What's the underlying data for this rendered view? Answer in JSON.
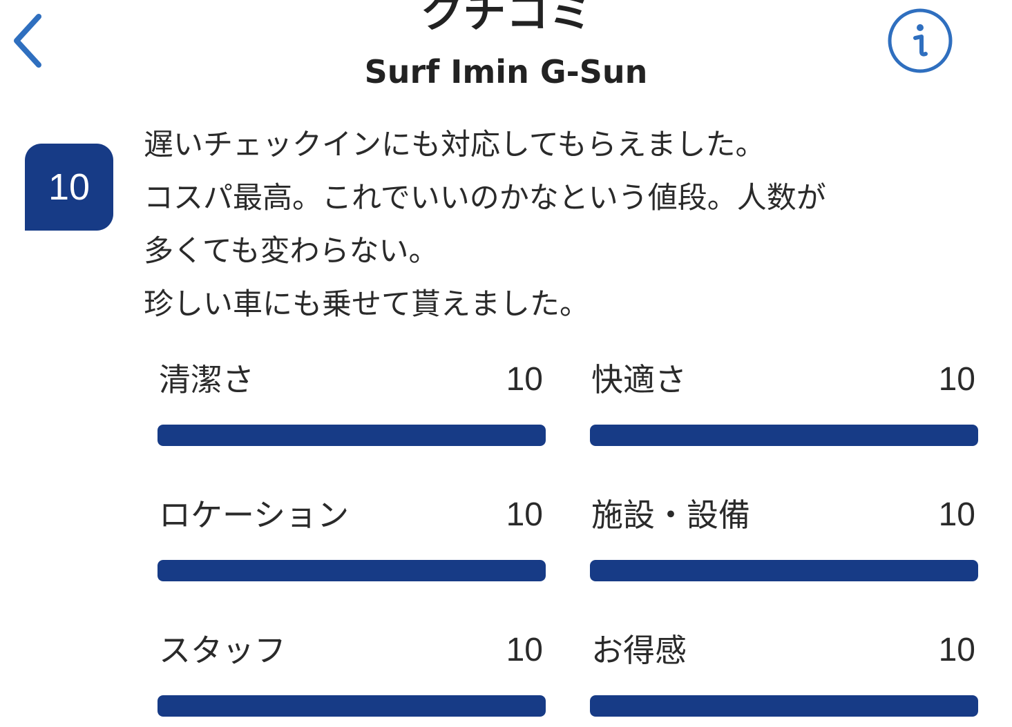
{
  "header": {
    "title": "クチコミ",
    "subtitle": "Surf Imin G-Sun",
    "back_icon": "chevron-left-icon",
    "info_icon": "info-icon"
  },
  "review": {
    "score": "10",
    "comment_lines": [
      "遅いチェックインにも対応してもらえました。",
      "コスパ最高。これでいいのかなという値段。人数が",
      "多くても変わらない。",
      "珍しい車にも乗せて貰えました。"
    ],
    "ratings": [
      {
        "label": "清潔さ",
        "value": "10",
        "fill": 1.0
      },
      {
        "label": "快適さ",
        "value": "10",
        "fill": 1.0
      },
      {
        "label": "ロケーション",
        "value": "10",
        "fill": 1.0
      },
      {
        "label": "施設・設備",
        "value": "10",
        "fill": 1.0
      },
      {
        "label": "スタッフ",
        "value": "10",
        "fill": 1.0
      },
      {
        "label": "お得感",
        "value": "10",
        "fill": 1.0
      }
    ]
  },
  "colors": {
    "accent": "#173b86",
    "link": "#2f6fbf",
    "text": "#222222"
  }
}
